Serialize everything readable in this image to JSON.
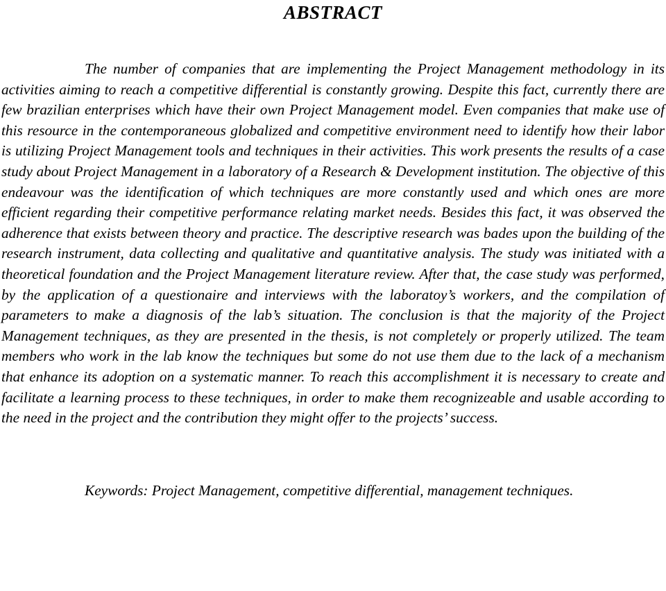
{
  "document": {
    "heading": "ABSTRACT",
    "abstract_paragraph": "The number of companies that are implementing the Project Management methodology in its activities aiming to reach a competitive differential is constantly growing. Despite this fact, currently there are few brazilian enterprises which have their own Project Management model. Even companies that make use of this resource in the contemporaneous globalized and competitive environment need to identify how their labor is utilizing Project Management tools and techniques in their activities. This work presents the results of a case study about Project Management in a laboratory of a Research & Development institution. The objective of this endeavour was the identification of which techniques are more constantly used and which ones are more efficient regarding their competitive performance relating market needs. Besides this fact, it was observed the adherence that exists between theory and practice. The descriptive research was bades upon the building of the research instrument, data collecting and qualitative and quantitative analysis. The study was initiated with a theoretical foundation and the Project Management literature review. After that, the case study was performed, by the application of a questionaire and interviews with the laboratoy’s workers, and the compilation of parameters to make a diagnosis of the lab’s situation. The conclusion is that the majority of the Project Management techniques, as they are presented in the thesis, is not completely or properly utilized. The team members who work in the lab know the techniques but some do not use them due to the lack of a mechanism that enhance its adoption on a systematic manner. To reach this accomplishment it is necessary to create and facilitate a learning process to these techniques, in order to make them recognizeable and usable according to the need in the project and the contribution they might offer to the projects’ success.",
    "keywords_line": "Keywords: Project Management, competitive differential, management techniques."
  }
}
